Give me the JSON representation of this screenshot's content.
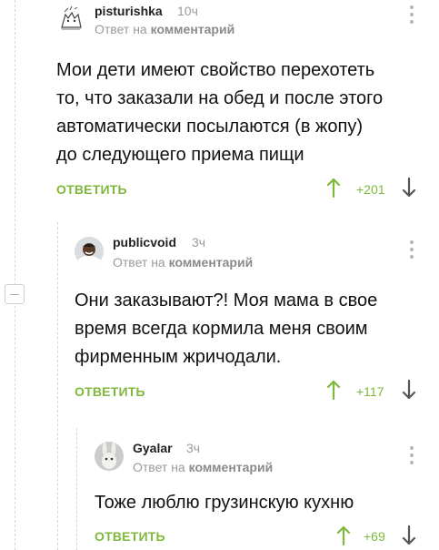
{
  "colors": {
    "accent": "#7fb83b",
    "muted": "#9a9a9a",
    "text": "#111111"
  },
  "comments": [
    {
      "username": "pisturishka",
      "time": "10ч",
      "reply_prefix": "Ответ на",
      "reply_target": "комментарий",
      "lines": [
        "Мои дети имеют свойство перехотеть",
        "то, что заказали на обед и после этого",
        "автоматически посылаются (в жопу)",
        "до следующего приема пищи"
      ],
      "reply_label": "ОТВЕТИТЬ",
      "score": "+201"
    },
    {
      "username": "publicvoid",
      "time": "3ч",
      "reply_prefix": "Ответ на",
      "reply_target": "комментарий",
      "lines": [
        "Они заказывают?! Моя мама в свое",
        "время всегда кормила меня своим",
        "фирменным жричодали."
      ],
      "reply_label": "ОТВЕТИТЬ",
      "score": "+117"
    },
    {
      "username": "Gyalar",
      "time": "3ч",
      "reply_prefix": "Ответ на",
      "reply_target": "комментарий",
      "lines": [
        "Тоже люблю грузинскую кухню"
      ],
      "reply_label": "ОТВЕТИТЬ",
      "score": "+69"
    }
  ]
}
